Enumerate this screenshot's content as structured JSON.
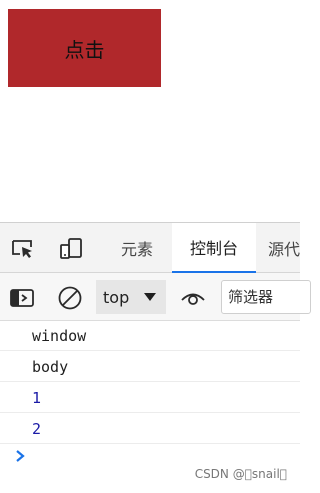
{
  "page": {
    "button_label": "点击"
  },
  "devtools": {
    "tabs": [
      {
        "label": "元素"
      },
      {
        "label": "控制台"
      },
      {
        "label": "源代"
      }
    ],
    "toolbar": {
      "context": "top",
      "filter_placeholder": "筛选器"
    },
    "console_logs": [
      "window",
      "body",
      "1",
      "2"
    ],
    "watermark": "CSDN @\u0000snail\u0000"
  },
  "colors": {
    "button_bg": "#b0282b",
    "active_tab_underline": "#1a73e8",
    "number_text": "#1a1aa6",
    "prompt": "#1a73e8"
  },
  "icons": {
    "inspect": "inspect-element-icon",
    "device": "device-toolbar-icon",
    "sidebar": "console-sidebar-icon",
    "clear": "clear-console-icon",
    "dropdown": "chevron-down-icon",
    "live_expression": "eye-icon",
    "prompt": "chevron-right-icon"
  }
}
